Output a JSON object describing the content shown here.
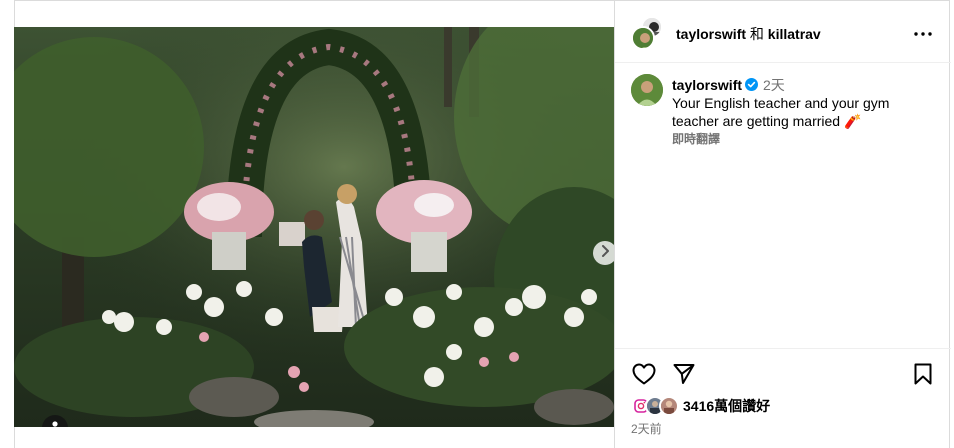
{
  "post": {
    "owner_primary": "taylorswift",
    "owner_conjunction": "和",
    "owner_secondary": "killatrav"
  },
  "caption": {
    "username": "taylorswift",
    "time_ago": "2天",
    "text": "Your English teacher and your gym teacher are getting married",
    "emoji": "🧨",
    "translate_label": "即時翻譯"
  },
  "engagement": {
    "likes_label": "3416萬個讚好",
    "date_label": "2天前"
  },
  "colors": {
    "verified": "#0095f6",
    "muted_text": "#737373",
    "border": "#dbdbdb"
  },
  "icons": [
    "gear-icon"
  ],
  "icon_names": {
    "more": "more-icon",
    "next": "chevron-right-icon",
    "user_tag": "user-icon",
    "like": "heart-icon",
    "share": "send-icon",
    "save": "bookmark-icon",
    "verified": "verified-badge-icon"
  }
}
